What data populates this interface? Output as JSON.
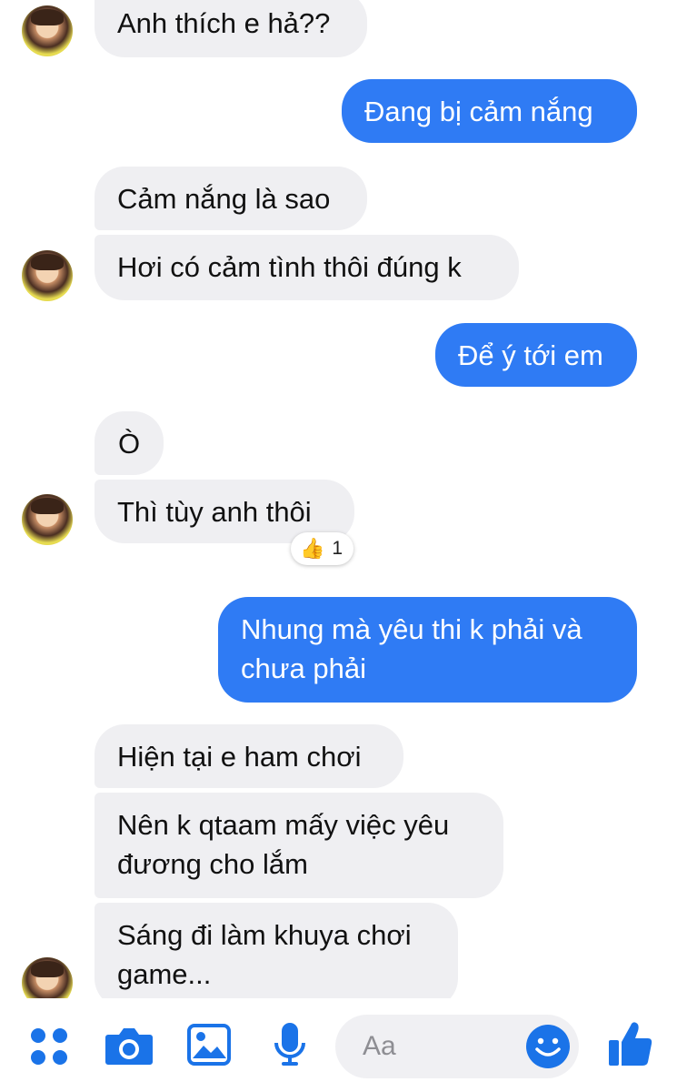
{
  "messages": [
    {
      "side": "in",
      "text": "Anh thích e hả??"
    },
    {
      "side": "out",
      "text": "Đang bị cảm nắng"
    },
    {
      "side": "in",
      "text": "Cảm nắng là sao"
    },
    {
      "side": "in",
      "text": "Hơi có cảm tình thôi đúng k"
    },
    {
      "side": "out",
      "text": "Để ý tới em"
    },
    {
      "side": "in",
      "text": "Ò"
    },
    {
      "side": "in",
      "text": "Thì tùy anh thôi"
    },
    {
      "side": "out",
      "text": "Nhung mà yêu thi k phải và\nchưa phải"
    },
    {
      "side": "in",
      "text": "Hiện tại e ham chơi"
    },
    {
      "side": "in",
      "text": "Nên k qtaam mấy việc yêu\nđương cho lắm"
    },
    {
      "side": "in",
      "text": "Sáng đi làm khuya chơi\ngame..."
    }
  ],
  "reaction": {
    "emoji": "👍",
    "count": "1"
  },
  "composer": {
    "placeholder": "Aa",
    "icons": [
      "apps-icon",
      "camera-icon",
      "image-icon",
      "microphone-icon",
      "emoji-icon",
      "thumbs-up-icon"
    ]
  },
  "colors": {
    "outgoing": "#2f7bf4",
    "incoming": "#efeff2",
    "icon": "#1a73e8"
  }
}
